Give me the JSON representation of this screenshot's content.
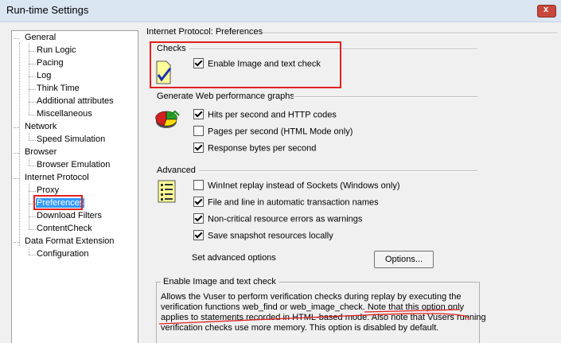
{
  "window": {
    "title": "Run-time Settings",
    "close_label": "x"
  },
  "tree": {
    "general": "General",
    "run_logic": "Run Logic",
    "pacing": "Pacing",
    "log": "Log",
    "think_time": "Think Time",
    "additional_attributes": "Additional attributes",
    "miscellaneous": "Miscellaneous",
    "network": "Network",
    "speed_simulation": "Speed Simulation",
    "browser": "Browser",
    "browser_emulation": "Browser Emulation",
    "internet_protocol": "Internet Protocol",
    "proxy": "Proxy",
    "preferences": "Preferences",
    "download_filters": "Download Filters",
    "contentcheck": "ContentCheck",
    "data_format_extension": "Data Format Extension",
    "configuration": "Configuration"
  },
  "panel": {
    "title": "Internet Protocol: Preferences",
    "checks": {
      "heading": "Checks",
      "enable_image_text": {
        "label": "Enable Image and text check",
        "checked": true
      }
    },
    "graphs": {
      "heading": "Generate Web performance graphs",
      "hits": {
        "label": "Hits per second and HTTP codes",
        "checked": true
      },
      "pages": {
        "label": "Pages per second (HTML Mode only)",
        "checked": false
      },
      "response": {
        "label": "Response bytes per second",
        "checked": true
      }
    },
    "advanced": {
      "heading": "Advanced",
      "wininet": {
        "label": "WinInet replay instead of Sockets (Windows only)",
        "checked": false
      },
      "file_line": {
        "label": "File and line in automatic transaction names",
        "checked": true
      },
      "noncritical": {
        "label": "Non-critical resource errors as warnings",
        "checked": true
      },
      "snapshot": {
        "label": "Save snapshot resources locally",
        "checked": true
      },
      "set_options_label": "Set advanced options",
      "options_button": "Options..."
    },
    "description": {
      "heading": "Enable Image and text check",
      "line1": "Allows the Vuser to perform verification checks during replay by executing the",
      "line2": "verification functions web_find or web_image_check. Note that this option only",
      "line3": "applies to statements recorded in HTML-based mode. Also note that Vusers running",
      "line4": "verification checks use more memory. This option is disabled by default."
    }
  },
  "colors": {
    "highlight_red": "#e02020",
    "selection_blue": "#3399ff"
  }
}
